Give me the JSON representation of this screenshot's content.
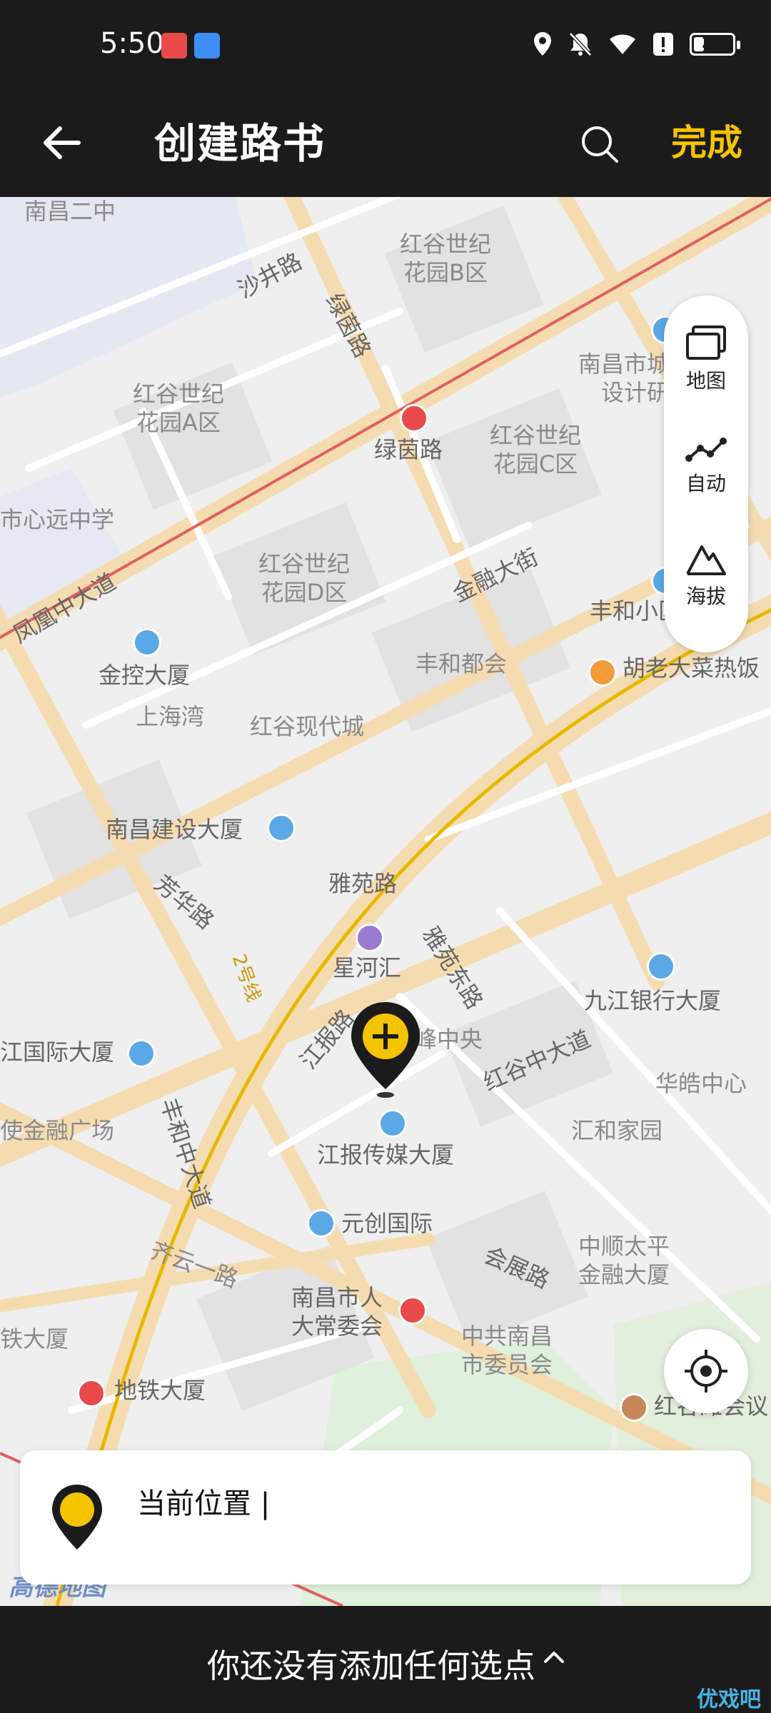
{
  "status_bar": {
    "time": "5:50",
    "battery": "24",
    "battery_level_percent": 24
  },
  "nav": {
    "title": "创建路书",
    "done_label": "完成"
  },
  "map": {
    "labels": [
      {
        "text": "南昌二中"
      },
      {
        "text": "沙井路"
      },
      {
        "text": "绿茵路"
      },
      {
        "text": "红谷世纪\n花园B区"
      },
      {
        "text": "南昌市城乡规划\n设计研究院"
      },
      {
        "text": "红谷世纪\n花园A区"
      },
      {
        "text": "绿茵路"
      },
      {
        "text": "红谷世纪\n花园C区"
      },
      {
        "text": "市心远中学"
      },
      {
        "text": "红谷世纪\n花园D区"
      },
      {
        "text": "金融大街"
      },
      {
        "text": "凤凰中大道"
      },
      {
        "text": "丰和小区"
      },
      {
        "text": "金控大厦"
      },
      {
        "text": "丰和都会"
      },
      {
        "text": "胡老大菜热饭"
      },
      {
        "text": "上海湾"
      },
      {
        "text": "红谷现代城"
      },
      {
        "text": "南昌建设大厦"
      },
      {
        "text": "雅苑路"
      },
      {
        "text": "芳华路"
      },
      {
        "text": "星河汇"
      },
      {
        "text": "雅苑东路"
      },
      {
        "text": "九江银行大厦"
      },
      {
        "text": "江国际大厦"
      },
      {
        "text": "鼎峰中央"
      },
      {
        "text": "江报路"
      },
      {
        "text": "红谷中大道"
      },
      {
        "text": "华皓中心"
      },
      {
        "text": "使金融广场"
      },
      {
        "text": "丰和中大道"
      },
      {
        "text": "江报传媒大厦"
      },
      {
        "text": "汇和家园"
      },
      {
        "text": "元创国际"
      },
      {
        "text": "中顺太平\n金融大厦"
      },
      {
        "text": "齐云一路"
      },
      {
        "text": "会展路"
      },
      {
        "text": "南昌市人\n大常委会"
      },
      {
        "text": "中共南昌\n市委员会"
      },
      {
        "text": "铁大厦"
      },
      {
        "text": "地铁大厦"
      },
      {
        "text": "红谷滩会议"
      },
      {
        "text": "2号线"
      }
    ],
    "logo": "高德地图"
  },
  "tools": {
    "map_label": "地图",
    "auto_label": "自动",
    "altitude_label": "海拔"
  },
  "location_card": {
    "text": "当前位置 |"
  },
  "bottom": {
    "text": "你还没有添加任何选点",
    "watermark": "优戏吧"
  },
  "colors": {
    "accent_yellow": "#f5c400",
    "bar_bg": "#1b1b1b",
    "map_bg": "#eeeeee",
    "road": "#f6deb6",
    "metro_line": "#e0b000",
    "rail_red": "#e05050"
  }
}
